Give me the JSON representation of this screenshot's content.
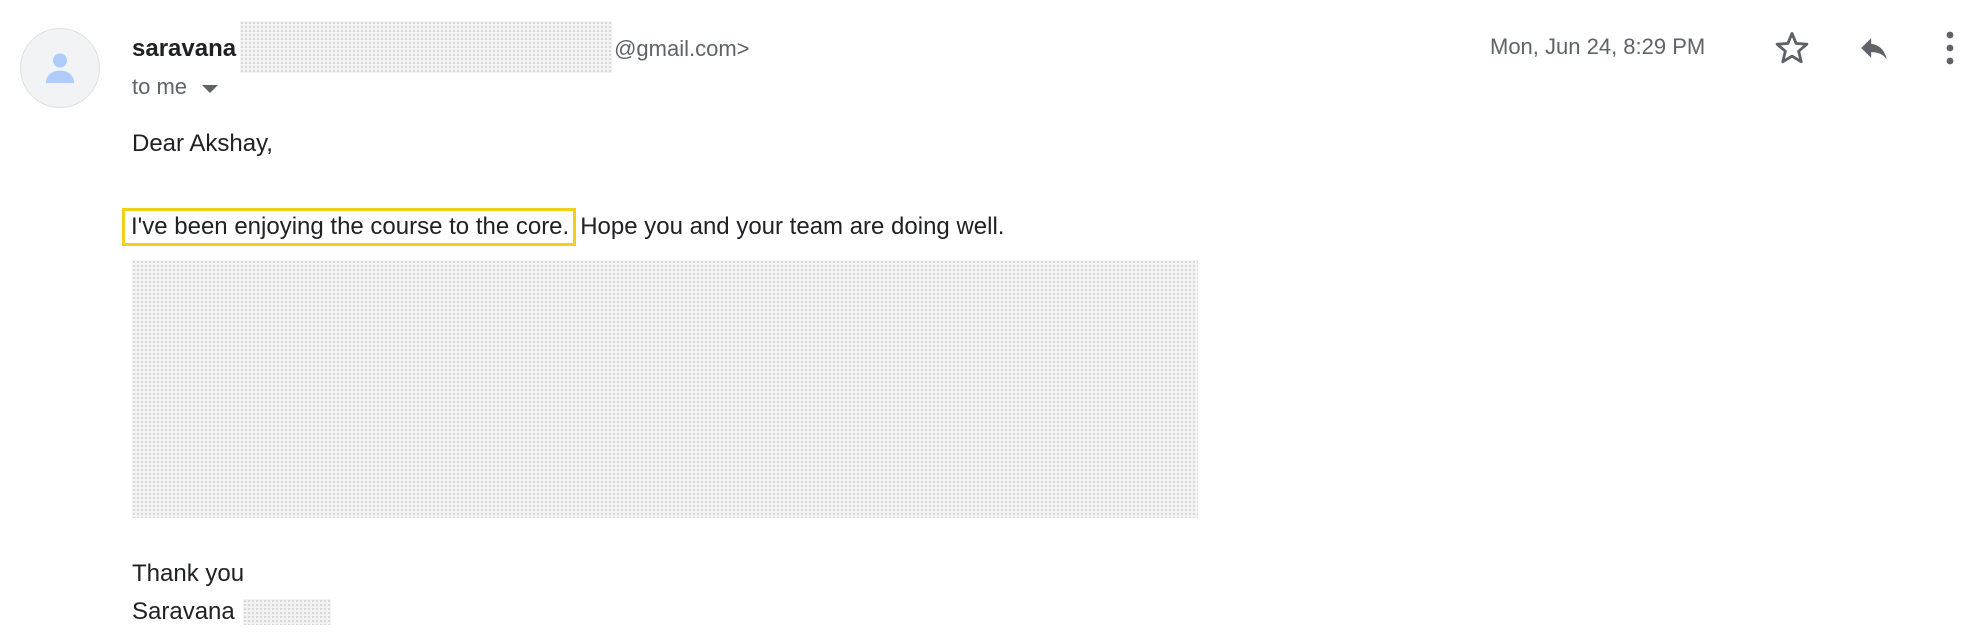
{
  "sender": {
    "name": "saravana",
    "email_suffix": "@gmail.com>",
    "recipient_label": "to me"
  },
  "date": "Mon, Jun 24, 8:29 PM",
  "icons": {
    "avatar": "person-icon",
    "star": "star-icon",
    "reply": "reply-icon",
    "more": "more-vert-icon",
    "caret": "caret-down-icon"
  },
  "body": {
    "greeting": "Dear Akshay,",
    "highlighted_sentence": "I've been enjoying the course to the core.",
    "rest_sentence": "Hope you and your team are doing well.",
    "closing": "Thank you",
    "signature_name": "Saravana"
  },
  "colors": {
    "highlight_border": "#f2cf18",
    "avatar_icon": "#aecbfa",
    "icon_gray": "#5f6368"
  }
}
